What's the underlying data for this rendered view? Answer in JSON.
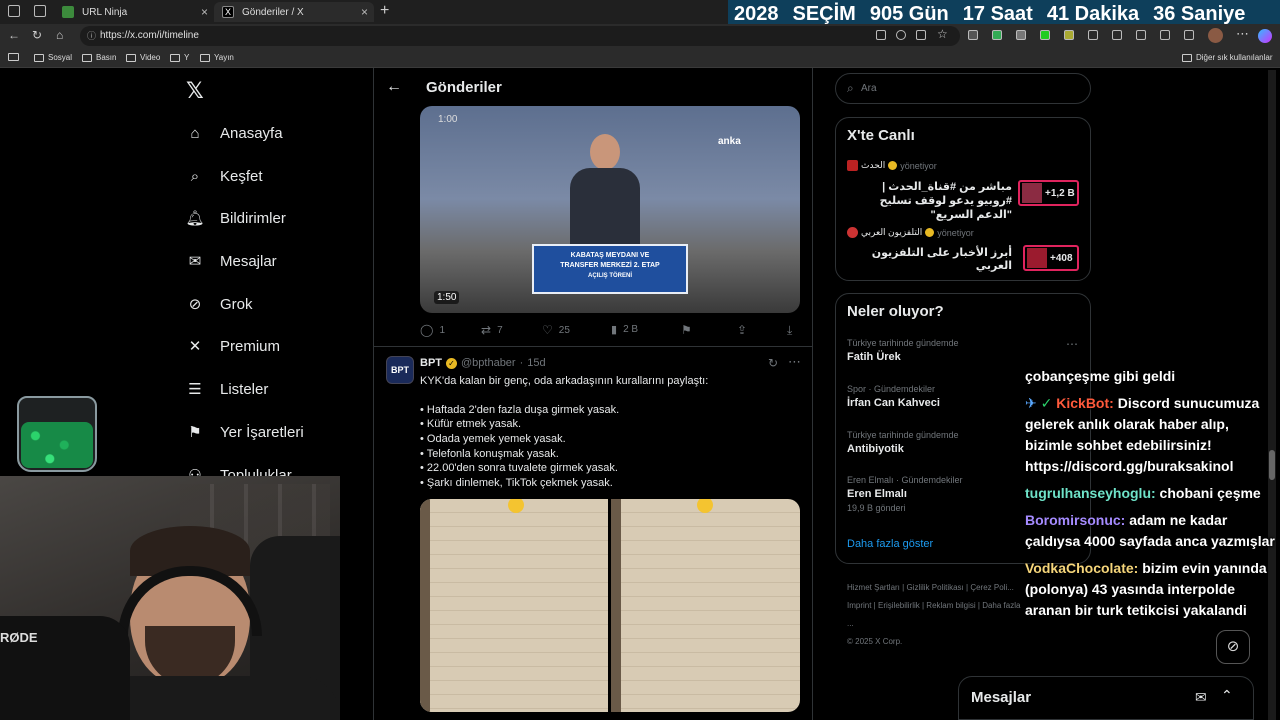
{
  "browser": {
    "tabs": [
      {
        "title": "URL Ninja"
      },
      {
        "title": "Gönderiler / X"
      }
    ],
    "url": "https://x.com/i/timeline",
    "bookmarks": [
      "Sosyal",
      "Basın",
      "Video",
      "Y",
      "Yayın"
    ],
    "other_bookmarks": "Diğer sık kullanılanlar"
  },
  "countdown": {
    "year": "2028",
    "label": "SEÇİM",
    "days": "905 Gün",
    "hours": "17 Saat",
    "minutes": "41 Dakika",
    "seconds": "36 Saniye"
  },
  "nav": {
    "items": [
      "Anasayfa",
      "Keşfet",
      "Bildirimler",
      "Mesajlar",
      "Grok",
      "Premium",
      "Listeler",
      "Yer İşaretleri",
      "Topluluklar"
    ]
  },
  "header": {
    "title": "Gönderiler"
  },
  "video": {
    "timestamp_top": "1:00",
    "duration": "1:50",
    "watermark": "anka",
    "podium_line1": "KABATAŞ MEYDANI VE",
    "podium_line2": "TRANSFER MERKEZİ 2. ETAP",
    "podium_line3": "AÇILIŞ TÖRENİ"
  },
  "tweet1_actions": {
    "replies": "1",
    "reposts": "7",
    "likes": "25",
    "views": "2 B"
  },
  "tweet2": {
    "name": "BPT",
    "handle": "@bpthaber",
    "time": "15d",
    "avatar_text": "BPT",
    "intro": "KYK'da kalan bir genç, oda arkadaşının kurallarını paylaştı:",
    "rules": [
      "• Haftada 2'den fazla duşa girmek yasak.",
      "• Küfür etmek yasak.",
      "• Odada yemek yemek yasak.",
      "• Telefonla konuşmak yasak.",
      "• 22.00'den sonra tuvalete girmek yasak.",
      "• Şarkı dinlemek, TikTok çekmek yasak."
    ]
  },
  "search": {
    "placeholder": "Ara"
  },
  "live": {
    "title": "X'te Canlı",
    "items": [
      {
        "host": "الحدث",
        "status": "yönetiyor",
        "text": "مباشر من #قناة_الحدث | #روبيو يدعو لوقف تسليح \"الدعم السريع\"",
        "count": "+1,2 B",
        "badge_color": "#e0245e"
      },
      {
        "host": "التلفزيون العربي",
        "status": "yönetiyor",
        "text": "أبرز الأخبار على التلفزيون العربي",
        "count": "+408",
        "badge_color": "#e0245e"
      }
    ]
  },
  "trends": {
    "title": "Neler oluyor?",
    "items": [
      {
        "context": "Türkiye tarihinde gündemde",
        "name": "Fatih Ürek"
      },
      {
        "context": "Spor · Gündemdekiler",
        "name": "İrfan Can Kahveci"
      },
      {
        "context": "Türkiye tarihinde gündemde",
        "name": "Antibiyotik"
      },
      {
        "context": "Eren Elmalı · Gündemdekiler",
        "name": "Eren Elmalı",
        "posts": "19,9 B gönderi"
      }
    ],
    "show_more": "Daha fazla göster"
  },
  "footer": {
    "links": [
      "Hizmet Şartları",
      "Gizlilik Politikası",
      "Çerez Poli...",
      "Imprint",
      "Erişilebilirlik",
      "Reklam bilgisi",
      "Daha fazla ..."
    ],
    "copyright": "© 2025 X Corp."
  },
  "messages_bar": {
    "label": "Mesajlar"
  },
  "chat": {
    "lines": [
      {
        "user": "",
        "text": "çobançeşme gibi geldi"
      },
      {
        "user": "KickBot:",
        "text": " Discord sunucumuza gelerek anlık olarak haber alıp, bizimle sohbet edebilirsiniz! https://discord.gg/buraksakinol"
      },
      {
        "user": "tugrulhanseyhoglu:",
        "text": " chobani çeşme"
      },
      {
        "user": "Boromirsonuc:",
        "text": " adam ne kadar çaldıysa 4000 sayfada anca yazmışlar"
      },
      {
        "user": "VodkaChocolate:",
        "text": " bizim evin yanında (polonya) 43 yasında interpolde aranan bir turk tetikcisi yakalandi"
      }
    ]
  },
  "webcam": {
    "mic_brand": "RØDE"
  },
  "colors": {
    "accent": "#1d9bf0",
    "countdown_bg": "#0e3f5b",
    "border": "#2f3336"
  }
}
